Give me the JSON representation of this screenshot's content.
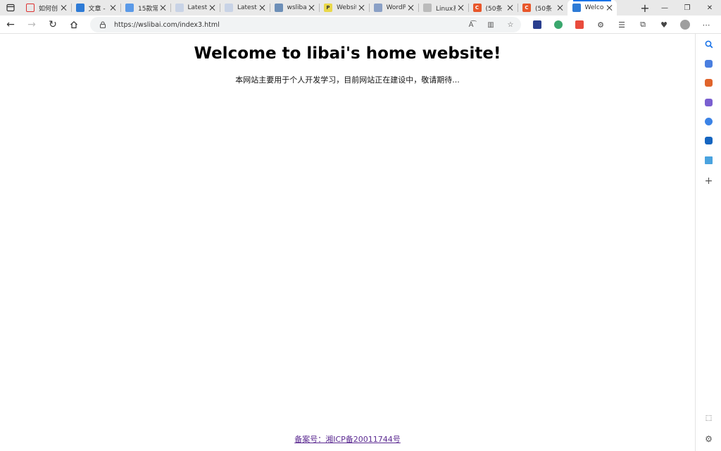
{
  "tabs": [
    {
      "title": "如何创",
      "fav_color": "#e8e8e8",
      "fav_text": "",
      "active": false,
      "fav_border": "#d33"
    },
    {
      "title": "文章 -",
      "fav_color": "#2e7bd6",
      "fav_text": "",
      "active": false
    },
    {
      "title": "15款常",
      "fav_color": "#5b9ae8",
      "fav_text": "",
      "active": false
    },
    {
      "title": "Latest",
      "fav_color": "#c8d3e6",
      "fav_text": "",
      "active": false
    },
    {
      "title": "Latest",
      "fav_color": "#c8d3e6",
      "fav_text": "",
      "active": false
    },
    {
      "title": "wslibai",
      "fav_color": "#6d8fb8",
      "fav_text": "",
      "active": false
    },
    {
      "title": "Websit",
      "fav_color": "#e9d84a",
      "fav_text": "P",
      "active": false
    },
    {
      "title": "WordP",
      "fav_color": "#8aa0c6",
      "fav_text": "",
      "active": false
    },
    {
      "title": "Linux系",
      "fav_color": "#bbbbbb",
      "fav_text": "",
      "active": false
    },
    {
      "title": "(50条",
      "fav_color": "#e8572b",
      "fav_text": "C",
      "active": false
    },
    {
      "title": "(50条",
      "fav_color": "#e8572b",
      "fav_text": "C",
      "active": false
    },
    {
      "title": "Welco",
      "fav_color": "#2e7bd6",
      "fav_text": "",
      "active": true
    }
  ],
  "address": {
    "url": "https://wslibai.com/index3.html"
  },
  "page": {
    "title": "Welcome to libai's home website!",
    "subtitle": "本网站主要用于个人开发学习，目前网站正在建设中，敬请期待...",
    "icp": "备案号：湘ICP备20011744号"
  },
  "colors": {
    "link_visited": "#5b2a91",
    "tab_strip": "#e9e9e9",
    "accent": "#1a73e8"
  }
}
